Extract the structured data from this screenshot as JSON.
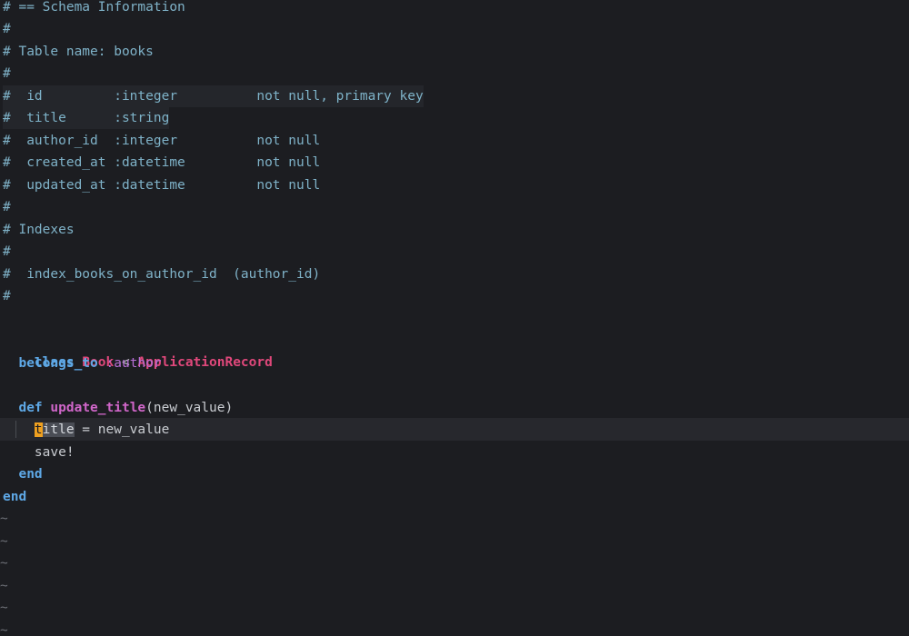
{
  "editor": {
    "schema_comment": [
      "# == Schema Information",
      "#",
      "# Table name: books",
      "#",
      "#  id         :integer          not null, primary key",
      "#  title      :string",
      "#  author_id  :integer          not null",
      "#  created_at :datetime         not null",
      "#  updated_at :datetime         not null",
      "#",
      "# Indexes",
      "#",
      "#  index_books_on_author_id  (author_id)",
      "#"
    ],
    "code": {
      "kw_class": "class",
      "class_name": "Book",
      "inherit_op": " < ",
      "parent_class": "ApplicationRecord",
      "kw_belongs_to": "belongs_to",
      "belongs_to_arg": " :author",
      "kw_def": "def",
      "method_name": "update_title",
      "method_params": "(new_value)",
      "cursor_char": "t",
      "selected_rest": "itle",
      "assign_rest": " = new_value",
      "save_call": "save!",
      "kw_end_inner": "end",
      "kw_end_outer": "end"
    },
    "empty_marker": "~",
    "colors": {
      "background": "#1c1d21",
      "comment": "#7fb2c8",
      "keyword": "#5ea8e6",
      "class_name": "#e0487b",
      "symbol": "#b86fd6",
      "cursor": "#f0a120"
    }
  }
}
